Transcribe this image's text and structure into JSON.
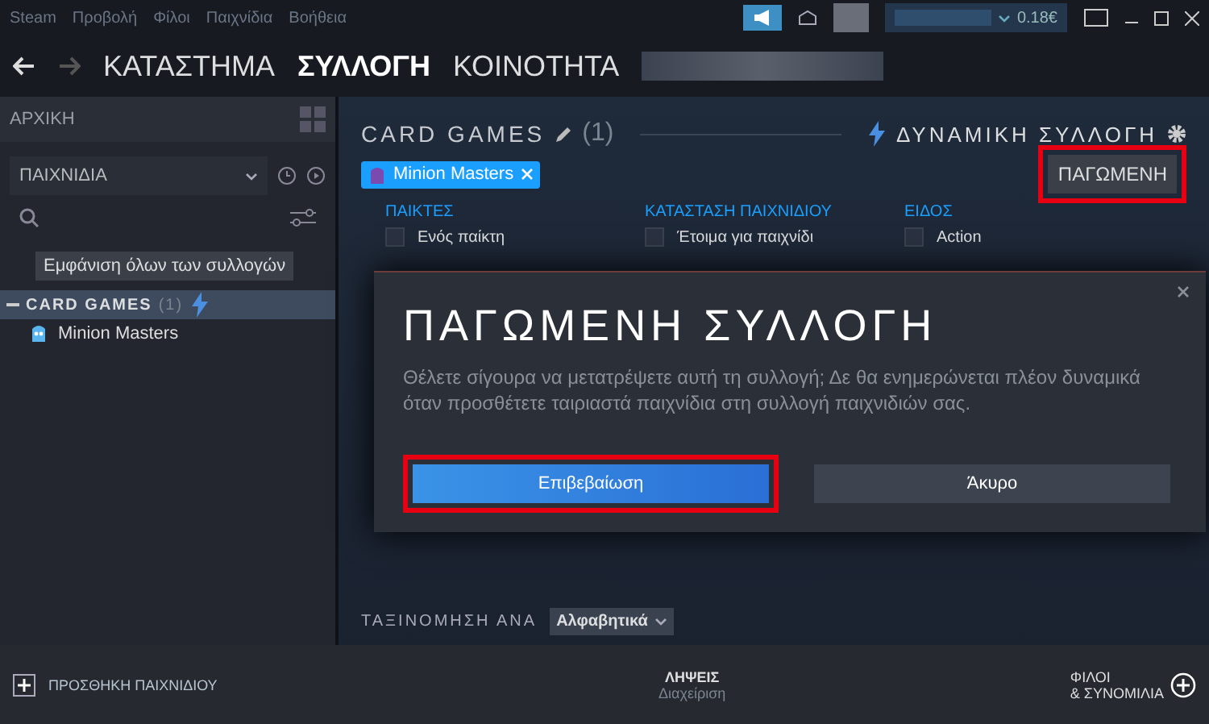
{
  "menu": [
    "Steam",
    "Προβολή",
    "Φίλοι",
    "Παιχνίδια",
    "Βοήθεια"
  ],
  "account": {
    "balance": "0.18€"
  },
  "nav": {
    "tabs": [
      {
        "label": "ΚΑΤΑΣΤΗΜΑ",
        "selected": false
      },
      {
        "label": "ΣΥΛΛΟΓΗ",
        "selected": true
      },
      {
        "label": "ΚΟΙΝΟΤΗΤΑ",
        "selected": false
      }
    ]
  },
  "sidebar": {
    "home": "ΑΡΧΙΚΗ",
    "filter": "ΠΑΙΧΝΙΔΙΑ",
    "tooltip": "Εμφάνιση όλων των συλλογών",
    "collections": [
      {
        "name": "CARD GAMES",
        "count": "(1)",
        "selected": true,
        "dynamic": true,
        "games": [
          "Minion Masters"
        ]
      }
    ]
  },
  "collection": {
    "title": "CARD GAMES",
    "count": "(1)",
    "type_label": "ΔΥΝΑΜΙΚΗ ΣΥΛΛΟΓΗ",
    "chips": [
      "Minion Masters"
    ],
    "freeze_button": {
      "label": "ΠΑΓΩΜΕΝΗ",
      "highlighted": true
    },
    "filters": [
      {
        "heading": "ΠΑΙΚΤΕΣ",
        "options": [
          {
            "label": "Ενός παίκτη",
            "checked": false
          }
        ]
      },
      {
        "heading": "ΚΑΤΑΣΤΑΣΗ ΠΑΙΧΝΙΔΙΟΥ",
        "options": [
          {
            "label": "Έτοιμα για παιχνίδι",
            "checked": false
          }
        ]
      },
      {
        "heading": "ΕΙΔΟΣ",
        "options": [
          {
            "label": "Action",
            "checked": false
          }
        ]
      }
    ],
    "sort": {
      "label": "ΤΑΞΙΝΟΜΗΣΗ ΑΝΑ",
      "value": "Αλφαβητικά"
    }
  },
  "dialog": {
    "title": "ΠΑΓΩΜΕΝΗ ΣΥΛΛΟΓΗ",
    "message": "Θέλετε σίγουρα να μετατρέψετε αυτή τη συλλογή; Δε θα ενημερώνεται πλέον δυναμικά όταν προσθέτετε ταιριαστά παιχνίδια στη συλλογή παιχνιδιών σας.",
    "buttons": [
      {
        "label": "Επιβεβαίωση",
        "kind": "primary",
        "highlighted": true
      },
      {
        "label": "Άκυρο",
        "kind": "secondary",
        "highlighted": false
      }
    ]
  },
  "bottom_bar": {
    "add_game": "ΠΡΟΣΘΗΚΗ ΠΑΙΧΝΙΔΙΟΥ",
    "downloads": {
      "title": "ΛΗΨΕΙΣ",
      "subtitle": "Διαχείριση"
    },
    "friends": [
      "ΦΙΛΟΙ",
      "& ΣΥΝΟΜΙΛΙΑ"
    ]
  }
}
